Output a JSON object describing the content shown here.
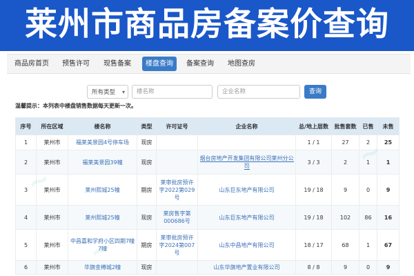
{
  "banner": {
    "title": "莱州市商品房备案价查询",
    "bg_color": "#1a57c8"
  },
  "nav": {
    "items": [
      "商品房首页",
      "预售许可",
      "现售备案",
      "楼盘查询",
      "备案查询",
      "地图查房"
    ],
    "active_index": 3,
    "active_color": "#3a7bc8"
  },
  "filters": {
    "type_select": "所有类型",
    "name_placeholder": "楼名称",
    "company_placeholder": "企业名称",
    "search_label": "查询"
  },
  "notice": {
    "prefix": "温馨提示：",
    "text": "本列表中楼盘销售数据每天更新一次。"
  },
  "table": {
    "headers": [
      "序号",
      "所在区域",
      "楼名称",
      "类型",
      "许可证号",
      "企业名称",
      "总/地上层数",
      "批售套数",
      "已售",
      "未售"
    ],
    "rows": [
      [
        "1",
        "莱州市",
        "福莱美景园4号停车场",
        "现房",
        "",
        "",
        "1 / 1",
        "27",
        "2",
        "25"
      ],
      [
        "2",
        "莱州市",
        "福莱美景园39幢",
        "现房",
        "",
        "烟台房地产开发集团有限公司莱州分公司",
        "3 / 3",
        "2",
        "1",
        "1"
      ],
      [
        "3",
        "莱州市",
        "莱州熙城25幢",
        "期房",
        "莱审批房预许字2022第029号",
        "山东巨东地产有限公司",
        "19 / 18",
        "9",
        "0",
        "9"
      ],
      [
        "4",
        "莱州市",
        "莱州熙城25幢",
        "现房",
        "莱房售字第000686号",
        "山东巨东地产有限公司",
        "19 / 18",
        "102",
        "86",
        "16"
      ],
      [
        "5",
        "莱州市",
        "中昌嘉和学府小区四期7幢7幢",
        "期房",
        "莱审批房预许字2024第007号",
        "山东中昌地产有限公司",
        "18 / 17",
        "68",
        "1",
        "67"
      ],
      [
        "6",
        "莱州市",
        "华旗金樽城2幢",
        "现房",
        "",
        "山东华旗地产置业有限公司",
        "8 / 8",
        "9",
        "0",
        "9"
      ]
    ]
  }
}
